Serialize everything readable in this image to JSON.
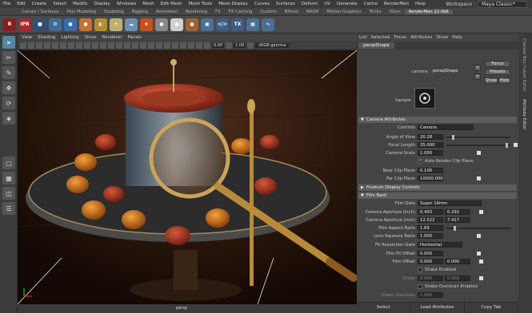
{
  "menubar": {
    "items": [
      "File",
      "Edit",
      "Create",
      "Select",
      "Modify",
      "Display",
      "Windows",
      "Mesh",
      "Edit Mesh",
      "Mesh Tools",
      "Mesh Display",
      "Curves",
      "Surfaces",
      "Deform",
      "UV",
      "Generate",
      "Cache",
      "RenderMan",
      "Help"
    ],
    "workspace_label": "Workspace :",
    "workspace_value": "Maya Classic*"
  },
  "shelf": {
    "tabs": [
      "Curves / Surfaces",
      "Poly Modeling",
      "Sculpting",
      "Rigging",
      "Animation",
      "Rendering",
      "FX",
      "FX Caching",
      "Custom",
      "Bifrost",
      "MASH",
      "Motion Graphics",
      "Tricks",
      "XGen",
      "RenderMan 22.0b6"
    ],
    "active_tab": "RenderMan 22.0b6",
    "icons": [
      {
        "name": "rman-icon",
        "glyph": "R",
        "color": "#8a1d1d"
      },
      {
        "name": "ipr-icon",
        "glyph": "IPR",
        "color": "#a52a2a"
      },
      {
        "name": "render-stop-icon",
        "glyph": "■",
        "color": "#2d4f7c"
      },
      {
        "name": "rman-settings-icon",
        "glyph": "⚙",
        "color": "#3c6e9b"
      },
      {
        "name": "light-blue-icon",
        "glyph": "●",
        "color": "#356ea8"
      },
      {
        "name": "light-orange-icon",
        "glyph": "●",
        "color": "#c4722f"
      },
      {
        "name": "light-yellow-icon",
        "glyph": "◐",
        "color": "#b58d2b"
      },
      {
        "name": "daylight-icon",
        "glyph": "☀",
        "color": "#c0b070"
      },
      {
        "name": "sky-icon",
        "glyph": "☁",
        "color": "#6b8fb2"
      },
      {
        "name": "star-icon",
        "glyph": "★",
        "color": "#c8501b"
      },
      {
        "name": "shader-gray-icon",
        "glyph": "●",
        "color": "#888888"
      },
      {
        "name": "shader-white-icon",
        "glyph": "●",
        "color": "#cfcfcf"
      },
      {
        "name": "shader-copper-icon",
        "glyph": "●",
        "color": "#a0622e"
      },
      {
        "name": "cube-icon",
        "glyph": "▣",
        "color": "#4d6f96"
      },
      {
        "name": "code-icon",
        "glyph": "</>",
        "color": "#3b5f86"
      },
      {
        "name": "tx-icon",
        "glyph": "TX",
        "color": "#3b5f86"
      },
      {
        "name": "checker-icon",
        "glyph": "▦",
        "color": "#4a6f95"
      },
      {
        "name": "wave-icon",
        "glyph": "∿",
        "color": "#4a6f95"
      }
    ]
  },
  "viewport": {
    "menu": [
      "View",
      "Shading",
      "Lighting",
      "Show",
      "Renderer",
      "Panels"
    ],
    "field_value_1": "0.00",
    "field_value_2": "1.00",
    "color_space": "sRGB gamma",
    "camera_label": "persp"
  },
  "attribute_editor": {
    "menu": [
      "List",
      "Selected",
      "Focus",
      "Attributes",
      "Show",
      "Help"
    ],
    "tab": "perspShape",
    "camera_label": "camera:",
    "camera_value": "perspShape",
    "focus_btn": "Focus",
    "presets_btn": "Presets",
    "show_btn": "Show",
    "hide_btn": "Hide",
    "sample_label": "Sample",
    "sections": {
      "camera_attributes": "Camera Attributes",
      "frustum": "Frustum Display Controls",
      "film_back": "Film Back"
    },
    "controls_label": "Controls",
    "controls_value": "Camera",
    "angle_of_view_label": "Angle of View",
    "angle_of_view": "20.28",
    "focal_length_label": "Focal Length",
    "focal_length": "35.000",
    "camera_scale_label": "Camera Scale",
    "camera_scale": "1.000",
    "auto_render_clip_label": "Auto Render Clip Plane",
    "auto_render_clip": true,
    "near_clip_label": "Near Clip Plane",
    "near_clip": "0.100",
    "far_clip_label": "Far Clip Plane",
    "far_clip": "10000.000",
    "film_gate_label": "Film Gate",
    "film_gate": "Super 16mm",
    "aperture_inch_label": "Camera Aperture (inch)",
    "aperture_inch_x": "0.493",
    "aperture_inch_y": "0.292",
    "aperture_mm_label": "Camera Aperture (mm)",
    "aperture_mm_x": "12.522",
    "aperture_mm_y": "7.417",
    "film_aspect_label": "Film Aspect Ratio",
    "film_aspect": "1.69",
    "lens_squeeze_label": "Lens Squeeze Ratio",
    "lens_squeeze": "1.000",
    "fit_resolution_label": "Fit Resolution Gate",
    "fit_resolution": "Horizontal",
    "film_fit_offset_label": "Film Fit Offset",
    "film_fit_offset": "0.000",
    "film_offset_label": "Film Offset",
    "film_offset_x": "0.000",
    "film_offset_y": "0.000",
    "shake_enabled_label": "Shake Enabled",
    "shake_label": "Shake",
    "shake_x": "0.000",
    "shake_y": "0.000",
    "shake_overscan_enabled_label": "Shake Overscan Enabled",
    "shake_overscan_label": "Shake Overscan",
    "shake_overscan": "1.000",
    "bottom_buttons": [
      "Select",
      "Load Attributes",
      "Copy Tab"
    ]
  },
  "right_tabs": [
    "Channel Box / Layer Editor",
    "Attribute Editor"
  ],
  "colors": {
    "accent": "#5285a6",
    "panel": "#444444",
    "field": "#2b2b2b"
  }
}
